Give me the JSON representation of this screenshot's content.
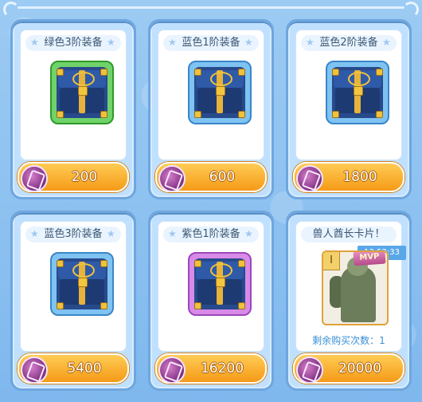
{
  "shop": {
    "items": [
      {
        "title": "绿色3阶装备",
        "price": "200",
        "theme": "green",
        "frame": "#6fd36a",
        "frame_dark": "#2e9a2a"
      },
      {
        "title": "蓝色1阶装备",
        "price": "600",
        "theme": "blue",
        "frame": "#7fc3f2",
        "frame_dark": "#3a86c8"
      },
      {
        "title": "蓝色2阶装备",
        "price": "1800",
        "theme": "blue",
        "frame": "#7fc3f2",
        "frame_dark": "#3a86c8"
      },
      {
        "title": "蓝色3阶装备",
        "price": "5400",
        "theme": "blue",
        "frame": "#7fc3f2",
        "frame_dark": "#3a86c8"
      },
      {
        "title": "紫色1阶装备",
        "price": "16200",
        "theme": "purple",
        "frame": "#d98ae8",
        "frame_dark": "#9b47b8"
      },
      {
        "title": "兽人酋长卡片！",
        "price": "20000",
        "theme": "card"
      }
    ],
    "card_extra": {
      "timer": "13:52:33",
      "rank": "I",
      "mvp_label": "MVP",
      "remaining_label": "剩余购买次数：1"
    }
  },
  "colors": {
    "background": "#8ec3f0",
    "price_bar": "#f59a17",
    "coin": "#8b3b8c",
    "chest_gold": "#f0c23c",
    "chest_navy": "#233a6b"
  },
  "icons": [
    "star-icon",
    "treasure-chest-icon",
    "purple-coin-icon",
    "orc-chief-card-icon",
    "mvp-badge-icon"
  ]
}
